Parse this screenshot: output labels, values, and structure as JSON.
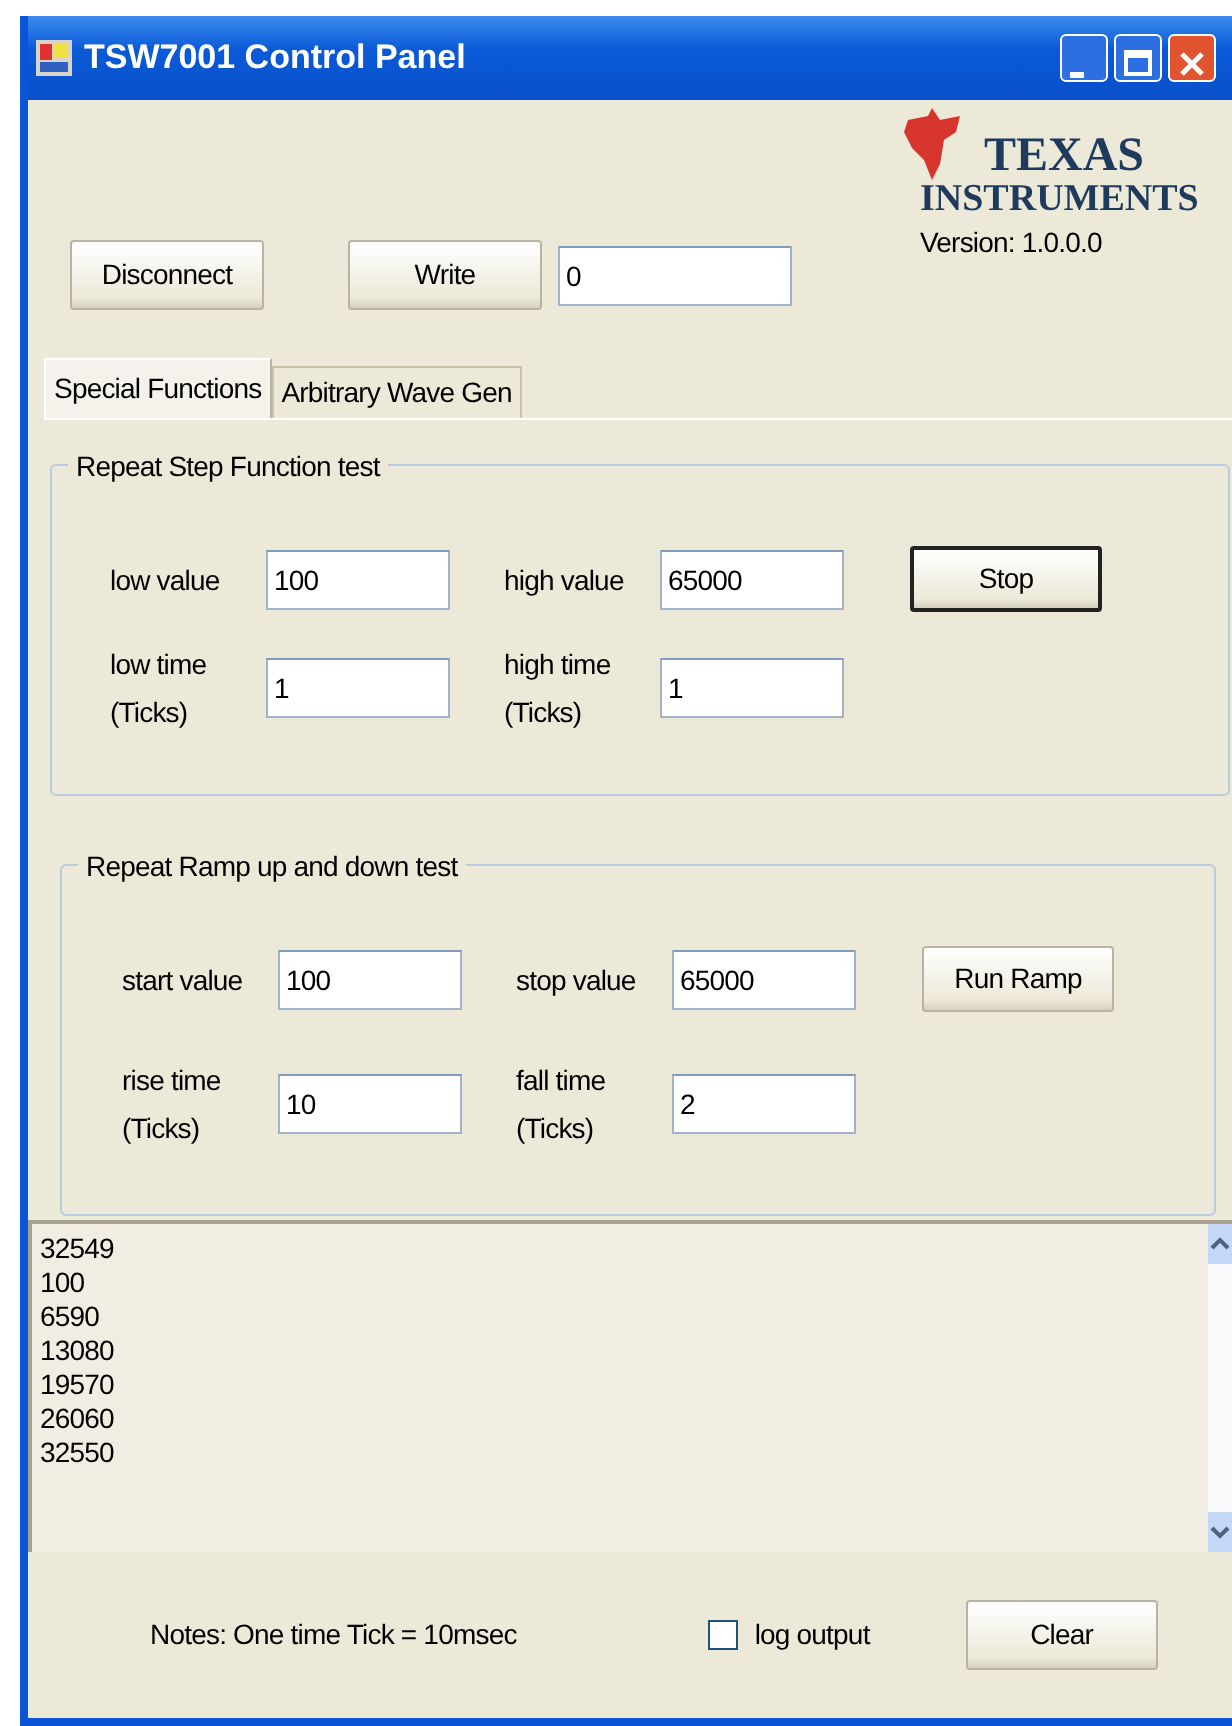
{
  "window": {
    "title": "TSW7001 Control Panel"
  },
  "logo": {
    "line_1": "TEXAS",
    "line_2": "INSTRUMENTS"
  },
  "version": "Version: 1.0.0.0",
  "toolbar": {
    "buttons": [
      "Disconnect",
      "Write"
    ],
    "value": "0"
  },
  "tabs": [
    {
      "label": "Special Functions",
      "selected": true
    },
    {
      "label": "Arbitrary Wave Gen",
      "selected": false
    }
  ],
  "groups": [
    {
      "title": "Repeat Step Function test",
      "button": {
        "label": "Stop",
        "default": true
      },
      "fields": [
        {
          "label": "low value",
          "value": "100"
        },
        {
          "label": "high value",
          "value": "65000"
        },
        {
          "label": "low time (Ticks)",
          "value": "1"
        },
        {
          "label": "high time (Ticks)",
          "value": "1"
        }
      ]
    },
    {
      "title": "Repeat Ramp up and down test",
      "button": {
        "label": "Run Ramp",
        "default": false
      },
      "fields": [
        {
          "label": "start value",
          "value": "100"
        },
        {
          "label": "stop value",
          "value": "65000"
        },
        {
          "label": "rise time (Ticks)",
          "value": "10"
        },
        {
          "label": "fall time (Ticks)",
          "value": "2"
        }
      ]
    }
  ],
  "log": [
    "32549",
    "100",
    "6590",
    "13080",
    "19570",
    "26060",
    "32550"
  ],
  "footer": {
    "note": "Notes: One time Tick = 10msec",
    "log_output": {
      "label": "log output",
      "checked": false
    },
    "button": "Clear"
  }
}
